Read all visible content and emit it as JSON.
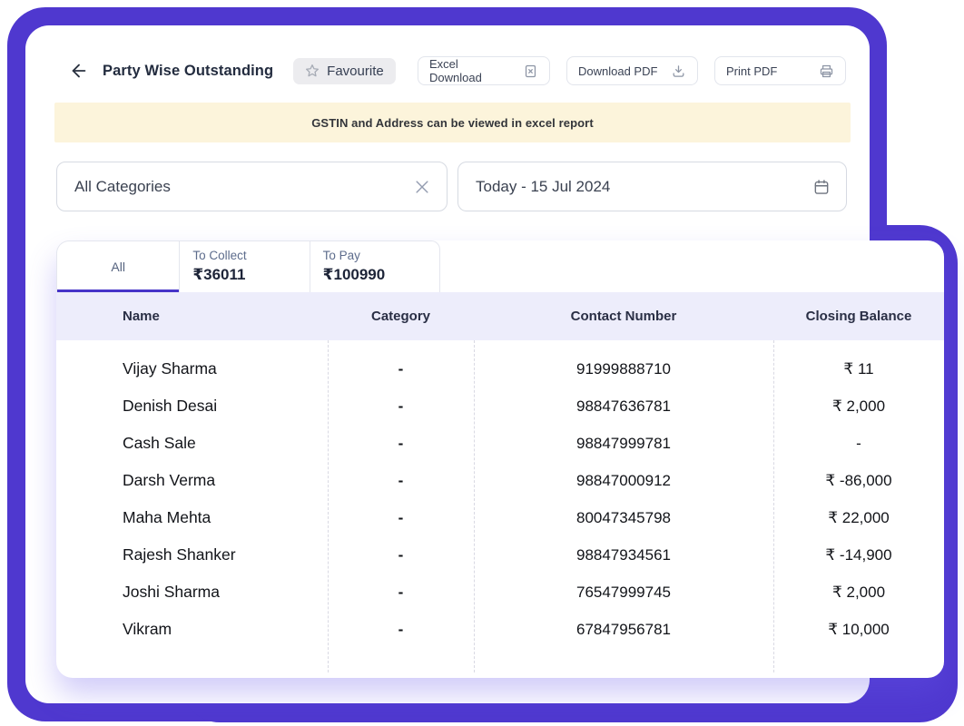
{
  "header": {
    "title": "Party Wise Outstanding",
    "favourite_label": "Favourite",
    "buttons": [
      {
        "label": "Excel Download",
        "icon": "excel-file-icon"
      },
      {
        "label": "Download PDF",
        "icon": "download-icon"
      },
      {
        "label": "Print PDF",
        "icon": "printer-icon"
      }
    ]
  },
  "banner": {
    "text": "GSTIN and Address can be viewed in excel report"
  },
  "filters": {
    "category": {
      "value": "All Categories"
    },
    "date_range": {
      "value": "Today - 15 Jul 2024"
    }
  },
  "tabs": [
    {
      "label": "All",
      "active": true
    },
    {
      "label": "To Collect",
      "amount": "₹36011"
    },
    {
      "label": "To Pay",
      "amount": "₹100990"
    }
  ],
  "table": {
    "columns": [
      "Name",
      "Category",
      "Contact Number",
      "Closing Balance"
    ],
    "rows": [
      {
        "name": "Vijay Sharma",
        "category": "-",
        "contact": "91999888710",
        "closing_balance": "₹ 11"
      },
      {
        "name": "Denish Desai",
        "category": "-",
        "contact": "98847636781",
        "closing_balance": "₹ 2,000"
      },
      {
        "name": "Cash Sale",
        "category": "-",
        "contact": "98847999781",
        "closing_balance": "-"
      },
      {
        "name": "Darsh Verma",
        "category": "-",
        "contact": "98847000912",
        "closing_balance": "₹ -86,000"
      },
      {
        "name": "Maha Mehta",
        "category": "-",
        "contact": "80047345798",
        "closing_balance": "₹ 22,000"
      },
      {
        "name": "Rajesh Shanker",
        "category": "-",
        "contact": "98847934561",
        "closing_balance": "₹ -14,900"
      },
      {
        "name": "Joshi Sharma",
        "category": "-",
        "contact": "76547999745",
        "closing_balance": "₹ 2,000"
      },
      {
        "name": "Vikram",
        "category": "-",
        "contact": "67847956781",
        "closing_balance": "₹ 10,000"
      }
    ]
  },
  "colors": {
    "accent_purple": "#4F38CF",
    "tab_underline": "#4634C8",
    "banner_bg": "#FCF4DB",
    "table_header_bg": "#EDEDFB"
  }
}
